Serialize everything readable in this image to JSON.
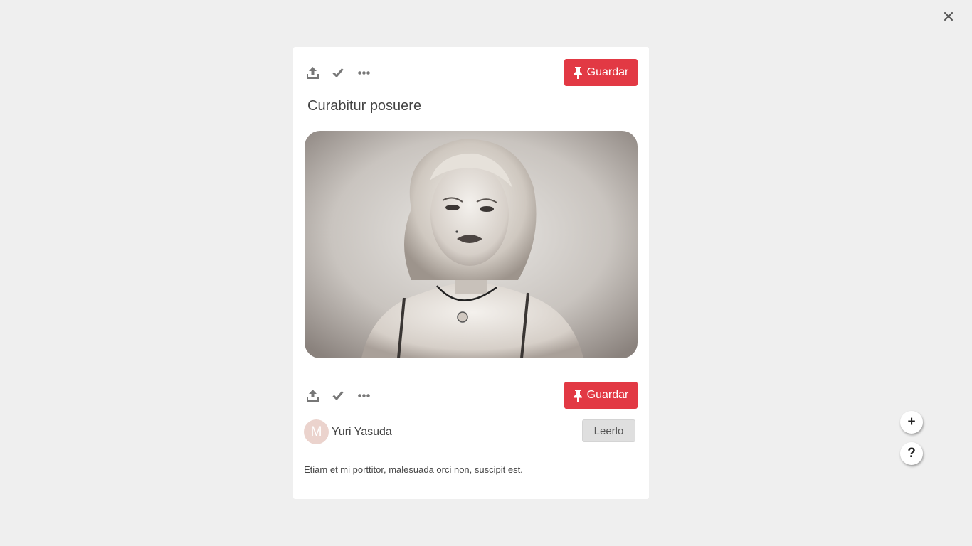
{
  "modal": {
    "close_icon": "close-icon",
    "title": "Curabitur posuere",
    "top_toolbar": {
      "icons": [
        "share-icon",
        "check-icon",
        "more-icon"
      ],
      "save_label": "Guardar"
    },
    "bottom_toolbar": {
      "icons": [
        "share-icon",
        "check-icon",
        "more-icon"
      ],
      "save_label": "Guardar"
    },
    "image": {
      "subject": "portrait-photo"
    },
    "author": {
      "initial": "M",
      "name": "Yuri Yasuda"
    },
    "read_label": "Leerlo",
    "description": "Etiam et mi porttitor, malesuada orci non, suscipit est."
  },
  "floating": {
    "add_symbol": "+",
    "help_symbol": "?"
  },
  "colors": {
    "accent": "#e23944",
    "background": "#efefef",
    "avatar": "#ebd3cd"
  }
}
